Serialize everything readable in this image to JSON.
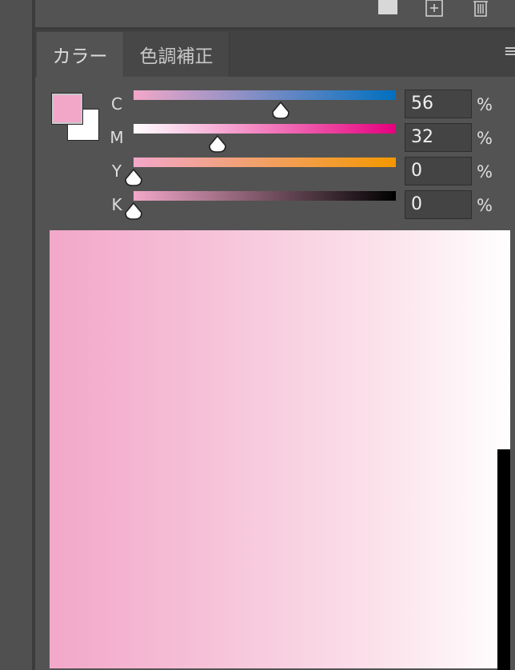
{
  "tabs": [
    {
      "label": "カラー",
      "active": true
    },
    {
      "label": "色調補正",
      "active": false
    }
  ],
  "colors": {
    "foreground": "#f2a7c9",
    "background": "#ffffff"
  },
  "channels": [
    {
      "label": "C",
      "value": "56",
      "unit": "%",
      "fraction": 0.56,
      "gradient": [
        "#f2a7c9",
        "#0070c0"
      ]
    },
    {
      "label": "M",
      "value": "32",
      "unit": "%",
      "fraction": 0.32,
      "gradient": [
        "#ffffff",
        "#e6007e"
      ]
    },
    {
      "label": "Y",
      "value": "0",
      "unit": "%",
      "fraction": 0.0,
      "gradient": [
        "#f2a7c9",
        "#f39800"
      ]
    },
    {
      "label": "K",
      "value": "0",
      "unit": "%",
      "fraction": 0.0,
      "gradient": [
        "#f2a7c9",
        "#000000"
      ]
    }
  ],
  "toolbar_icons": [
    "folder-icon",
    "new-layer-icon",
    "trash-icon"
  ],
  "panel_menu_icon": "hamburger-menu-icon"
}
